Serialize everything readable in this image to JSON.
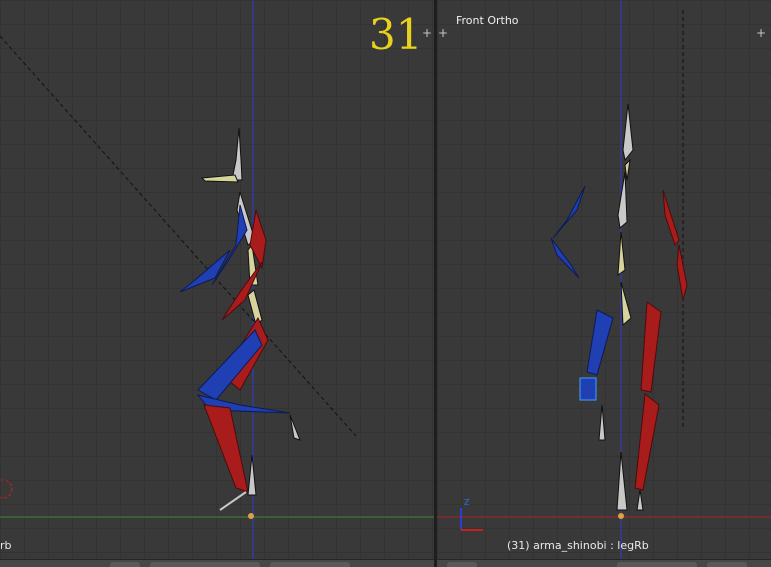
{
  "left_viewport": {
    "frame_number": "31",
    "status_text": "rb"
  },
  "right_viewport": {
    "view_label": "Front Ortho",
    "status_text": "(31) arma_shinobi : legRb",
    "axis_label": "Z"
  },
  "corner_widget": "+",
  "colors": {
    "bone_left": "#1f3fb3",
    "bone_right": "#a81c1c",
    "bone_center": "#c8c8c8",
    "bone_spine": "#d6d49a",
    "frame_number": "#e8d21d"
  }
}
